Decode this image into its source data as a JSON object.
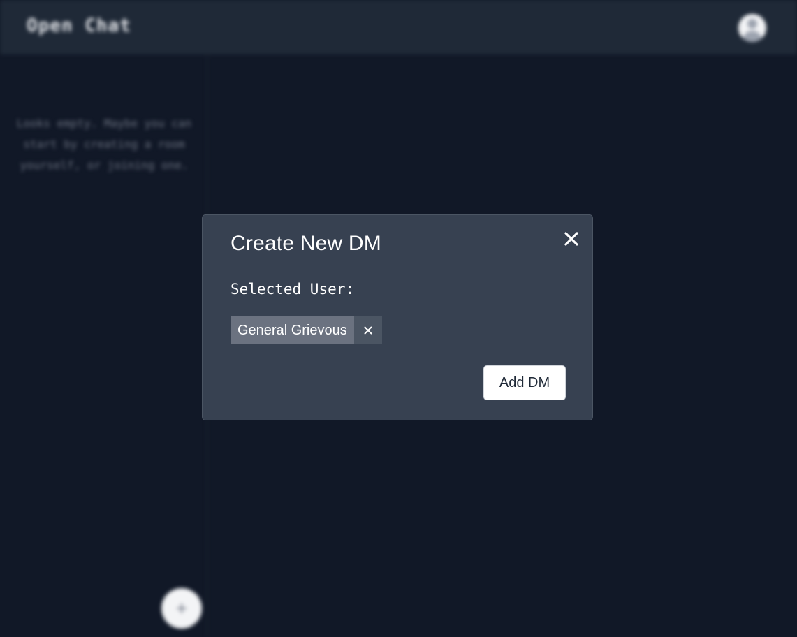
{
  "app": {
    "brand": "Open Chat"
  },
  "sidebar": {
    "empty_message": "Looks empty. Maybe you can start by creating a room yourself, or joining one.",
    "fab_icon": "plus-icon"
  },
  "modal": {
    "title": "Create New DM",
    "close_icon": "close-icon",
    "selected_label": "Selected User:",
    "selected_user": "General Grievous",
    "remove_icon": "close-icon",
    "submit_label": "Add DM"
  },
  "colors": {
    "background": "#111827",
    "topbar": "#1f2937",
    "modal": "#374151",
    "chip": "#6b7280",
    "chip_remove": "#4b5563"
  }
}
